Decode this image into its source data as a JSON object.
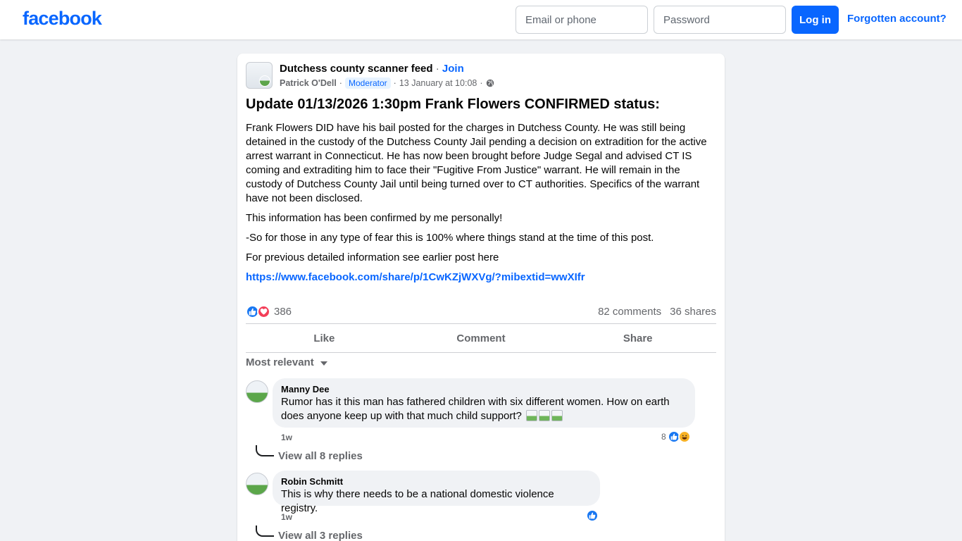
{
  "header": {
    "logo": "facebook",
    "email_placeholder": "Email or phone",
    "password_placeholder": "Password",
    "login_label": "Log in",
    "forgot_label": "Forgotten account?"
  },
  "post": {
    "group_name": "Dutchess county scanner feed",
    "join_label": "Join",
    "author": "Patrick O'Dell",
    "badge": "Moderator",
    "timestamp": "13 January at 10:08",
    "title": "Update 01/13/2026 1:30pm Frank Flowers CONFIRMED status:",
    "paragraphs": [
      "Frank Flowers DID have his bail posted for the charges in Dutchess County. He was still being detained in the custody of the Dutchess County Jail pending a decision on extradition for the active arrest warrant in Connecticut. He has now been brought before Judge Segal and advised CT IS coming and extraditing him to face their \"Fugitive From Justice\" warrant. He will remain in the custody of Dutchess County Jail until being turned over to CT authorities. Specifics of the warrant have not been disclosed.",
      "This information has been confirmed by me personally!",
      "-So for those in any type of fear this is 100% where things stand at the time of this post.",
      "For previous detailed information see earlier post here"
    ],
    "link": "https://www.facebook.com/share/p/1CwKZjWXVg/?mibextid=wwXIfr",
    "reaction_count": "386",
    "comments_count": "82 comments",
    "shares_count": "36 shares",
    "actions": {
      "like": "Like",
      "comment": "Comment",
      "share": "Share"
    },
    "sort_label": "Most relevant"
  },
  "comments": [
    {
      "name": "Manny Dee",
      "text": "Rumor has it this man has fathered children with six different women. How on earth does anyone keep up with that much child support?",
      "time": "1w",
      "reactions": "8",
      "replies": "View all 8 replies"
    },
    {
      "name": "Robin Schmitt",
      "text": "This is why there needs to be a national domestic violence registry.",
      "time": "1w",
      "reactions": "",
      "replies": "View all 3 replies"
    }
  ],
  "colors": {
    "brand": "#0866ff",
    "page_bg": "#f0f2f5",
    "like": "#1877f2",
    "love": "#f33e58"
  }
}
